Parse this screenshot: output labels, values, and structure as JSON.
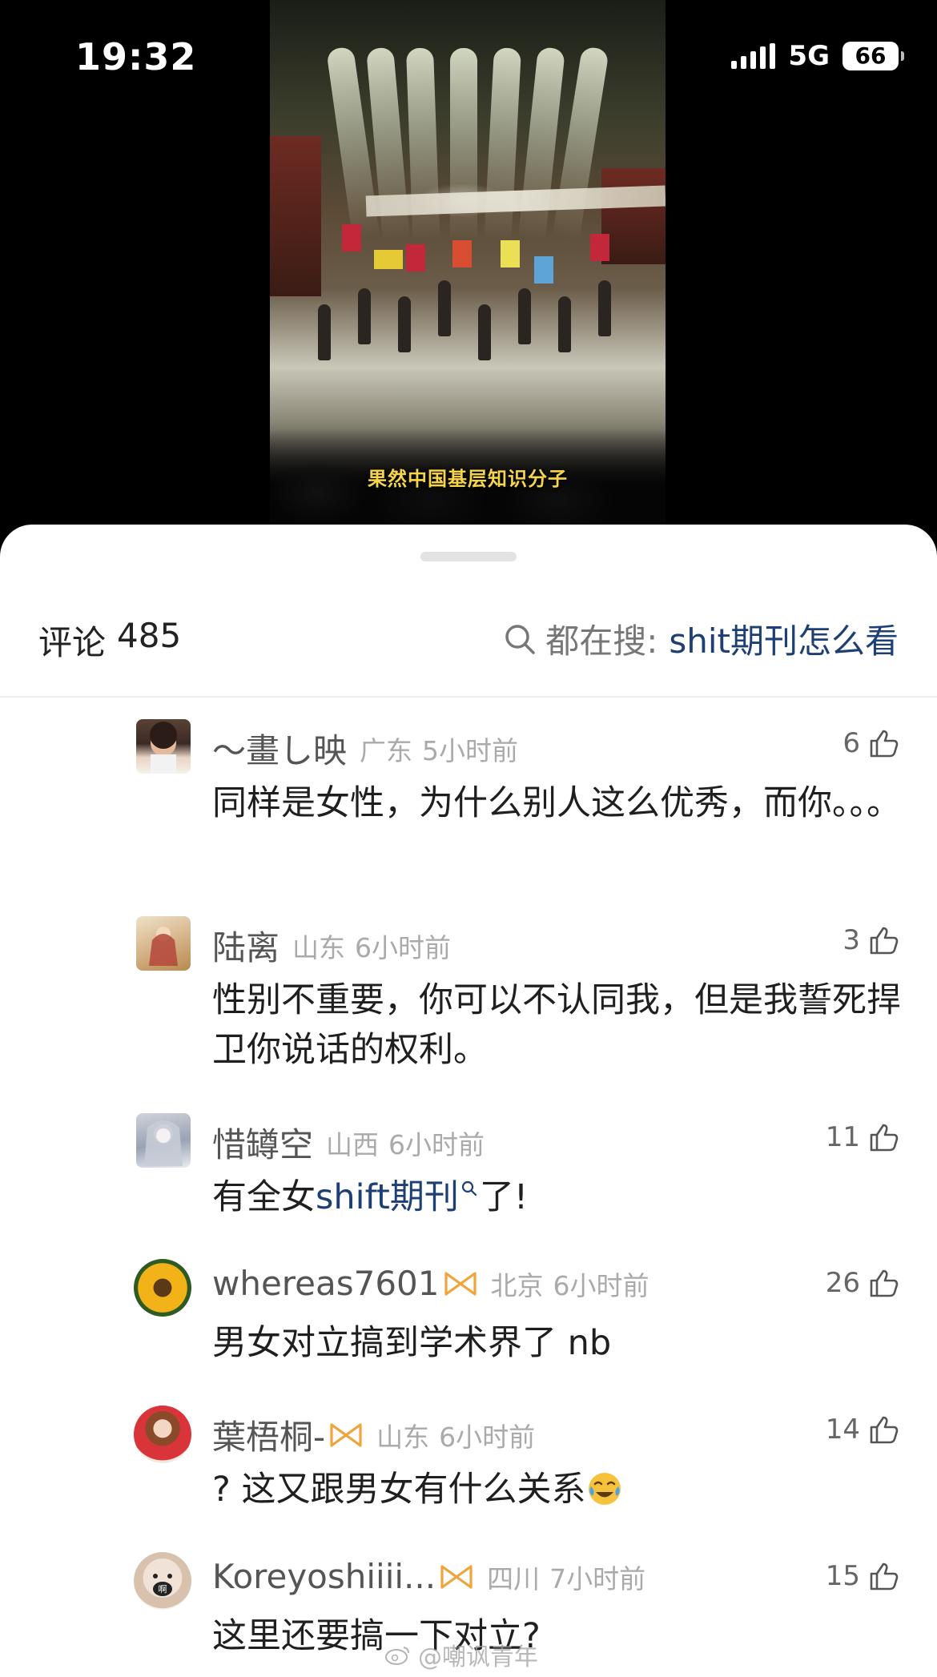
{
  "status_bar": {
    "time": "19:32",
    "network": "5G",
    "battery": "66"
  },
  "video": {
    "subtitle": "果然中国基层知识分子"
  },
  "sheet": {
    "comment_label": "评论",
    "comment_count": "485",
    "hot_search_prefix": "都在搜:",
    "hot_search_term": "shit期刊怎么看"
  },
  "comments": [
    {
      "user": "～畫し映",
      "region": "广东",
      "time": "5小时前",
      "likes": "6",
      "text": "同样是女性，为什么别人这么优秀，而你。。。"
    },
    {
      "user": "陆离",
      "region": "山东",
      "time": "6小时前",
      "likes": "3",
      "text": "性别不重要，你可以不认同我，但是我誓死捍卫你说话的权利。"
    },
    {
      "user": "惜罇空",
      "region": "山西",
      "time": "6小时前",
      "likes": "11",
      "text_before": "有全女",
      "text_link": "shift期刊",
      "text_after": "了!"
    },
    {
      "user": "whereas7601",
      "region": "北京",
      "time": "6小时前",
      "likes": "26",
      "text": "男女对立搞到学术界了 nb"
    },
    {
      "user": "葉梧桐-",
      "region": "山东",
      "time": "6小时前",
      "likes": "14",
      "text": "? 这又跟男女有什么关系"
    },
    {
      "user": "Koreyoshiiii...",
      "region": "四川",
      "time": "7小时前",
      "likes": "15",
      "text": "这里还要搞一下对立?"
    }
  ],
  "watermark": "@嘲讽青年",
  "colors": {
    "link": "#1d3f73",
    "vip_badge": "#f0a43c",
    "subtitle": "#f6d54a"
  }
}
